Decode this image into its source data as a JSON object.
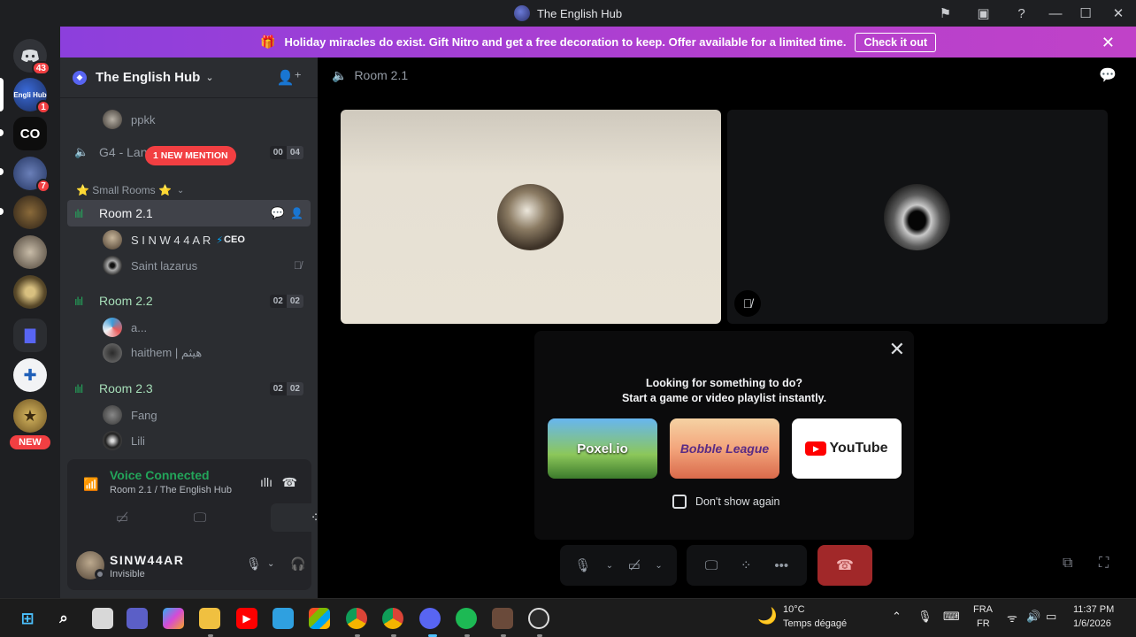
{
  "window": {
    "title": "The English Hub",
    "controls": {
      "flag": "⚑",
      "inbox": "▣",
      "help": "?",
      "minimize": "—",
      "maximize": "☐",
      "close": "✕"
    }
  },
  "rail": {
    "home_badge": "43",
    "servers": [
      {
        "name": "English Hub",
        "short": "Engli Hub",
        "badge": "1"
      },
      {
        "name": "CO",
        "short": "CO",
        "badge": ""
      },
      {
        "name": "server-3",
        "short": "",
        "badge": "7"
      },
      {
        "name": "server-4",
        "short": "",
        "badge": ""
      },
      {
        "name": "server-5",
        "short": "",
        "badge": ""
      },
      {
        "name": "server-6",
        "short": "",
        "badge": ""
      },
      {
        "name": "folder",
        "short": "▇",
        "badge": ""
      },
      {
        "name": "server-8",
        "short": "✚",
        "badge": ""
      },
      {
        "name": "server-9",
        "short": "★",
        "badge": ""
      }
    ],
    "new_label": "NEW"
  },
  "banner": {
    "message": "Holiday miracles do exist. Gift Nitro and get a free decoration to keep. Offer available for a limited time.",
    "cta": "Check it out",
    "close": "✕"
  },
  "sidebar": {
    "server_name": "The English Hub",
    "mention_badge": "1 NEW MENTION",
    "partial_user": "ppkk",
    "channels": {
      "g4": {
        "name": "G4 - Language Jungle",
        "count_a": "00",
        "count_b": "04"
      },
      "category": "⭐ Small Rooms ⭐",
      "room21": {
        "name": "Room 2.1",
        "users": [
          {
            "name": "S I N W 4 4 A R",
            "tag": "CEO"
          },
          {
            "name": "Saint lazarus",
            "trailing": "mic-off"
          }
        ]
      },
      "room22": {
        "name": "Room 2.2",
        "count_a": "02",
        "count_b": "02",
        "users": [
          {
            "name": "a..."
          },
          {
            "name": "haithem | هيثم"
          }
        ]
      },
      "room23": {
        "name": "Room 2.3",
        "count_a": "02",
        "count_b": "02",
        "users": [
          {
            "name": "Fang"
          },
          {
            "name": "Lili"
          }
        ]
      }
    }
  },
  "voice_panel": {
    "status": "Voice Connected",
    "location": "Room 2.1 / The English Hub"
  },
  "user": {
    "name": "SINW44AR",
    "status": "Invisible"
  },
  "main": {
    "channel": "Room 2.1",
    "activity": {
      "line1": "Looking for something to do?",
      "line2": "Start a game or video playlist instantly.",
      "cards": [
        "Poxel.io",
        "Bobble League",
        "YouTube"
      ],
      "checkbox_label": "Don't show again"
    }
  },
  "taskbar": {
    "weather_temp": "10°C",
    "weather_desc": "Temps dégagé",
    "lang_1": "FRA",
    "lang_2": "FR",
    "time": "11:37 PM",
    "date": "1/6/2026"
  },
  "colors": {
    "accent": "#5865f2",
    "green": "#23a55a",
    "danger": "#f23f42",
    "banner": "#b23fcf"
  }
}
